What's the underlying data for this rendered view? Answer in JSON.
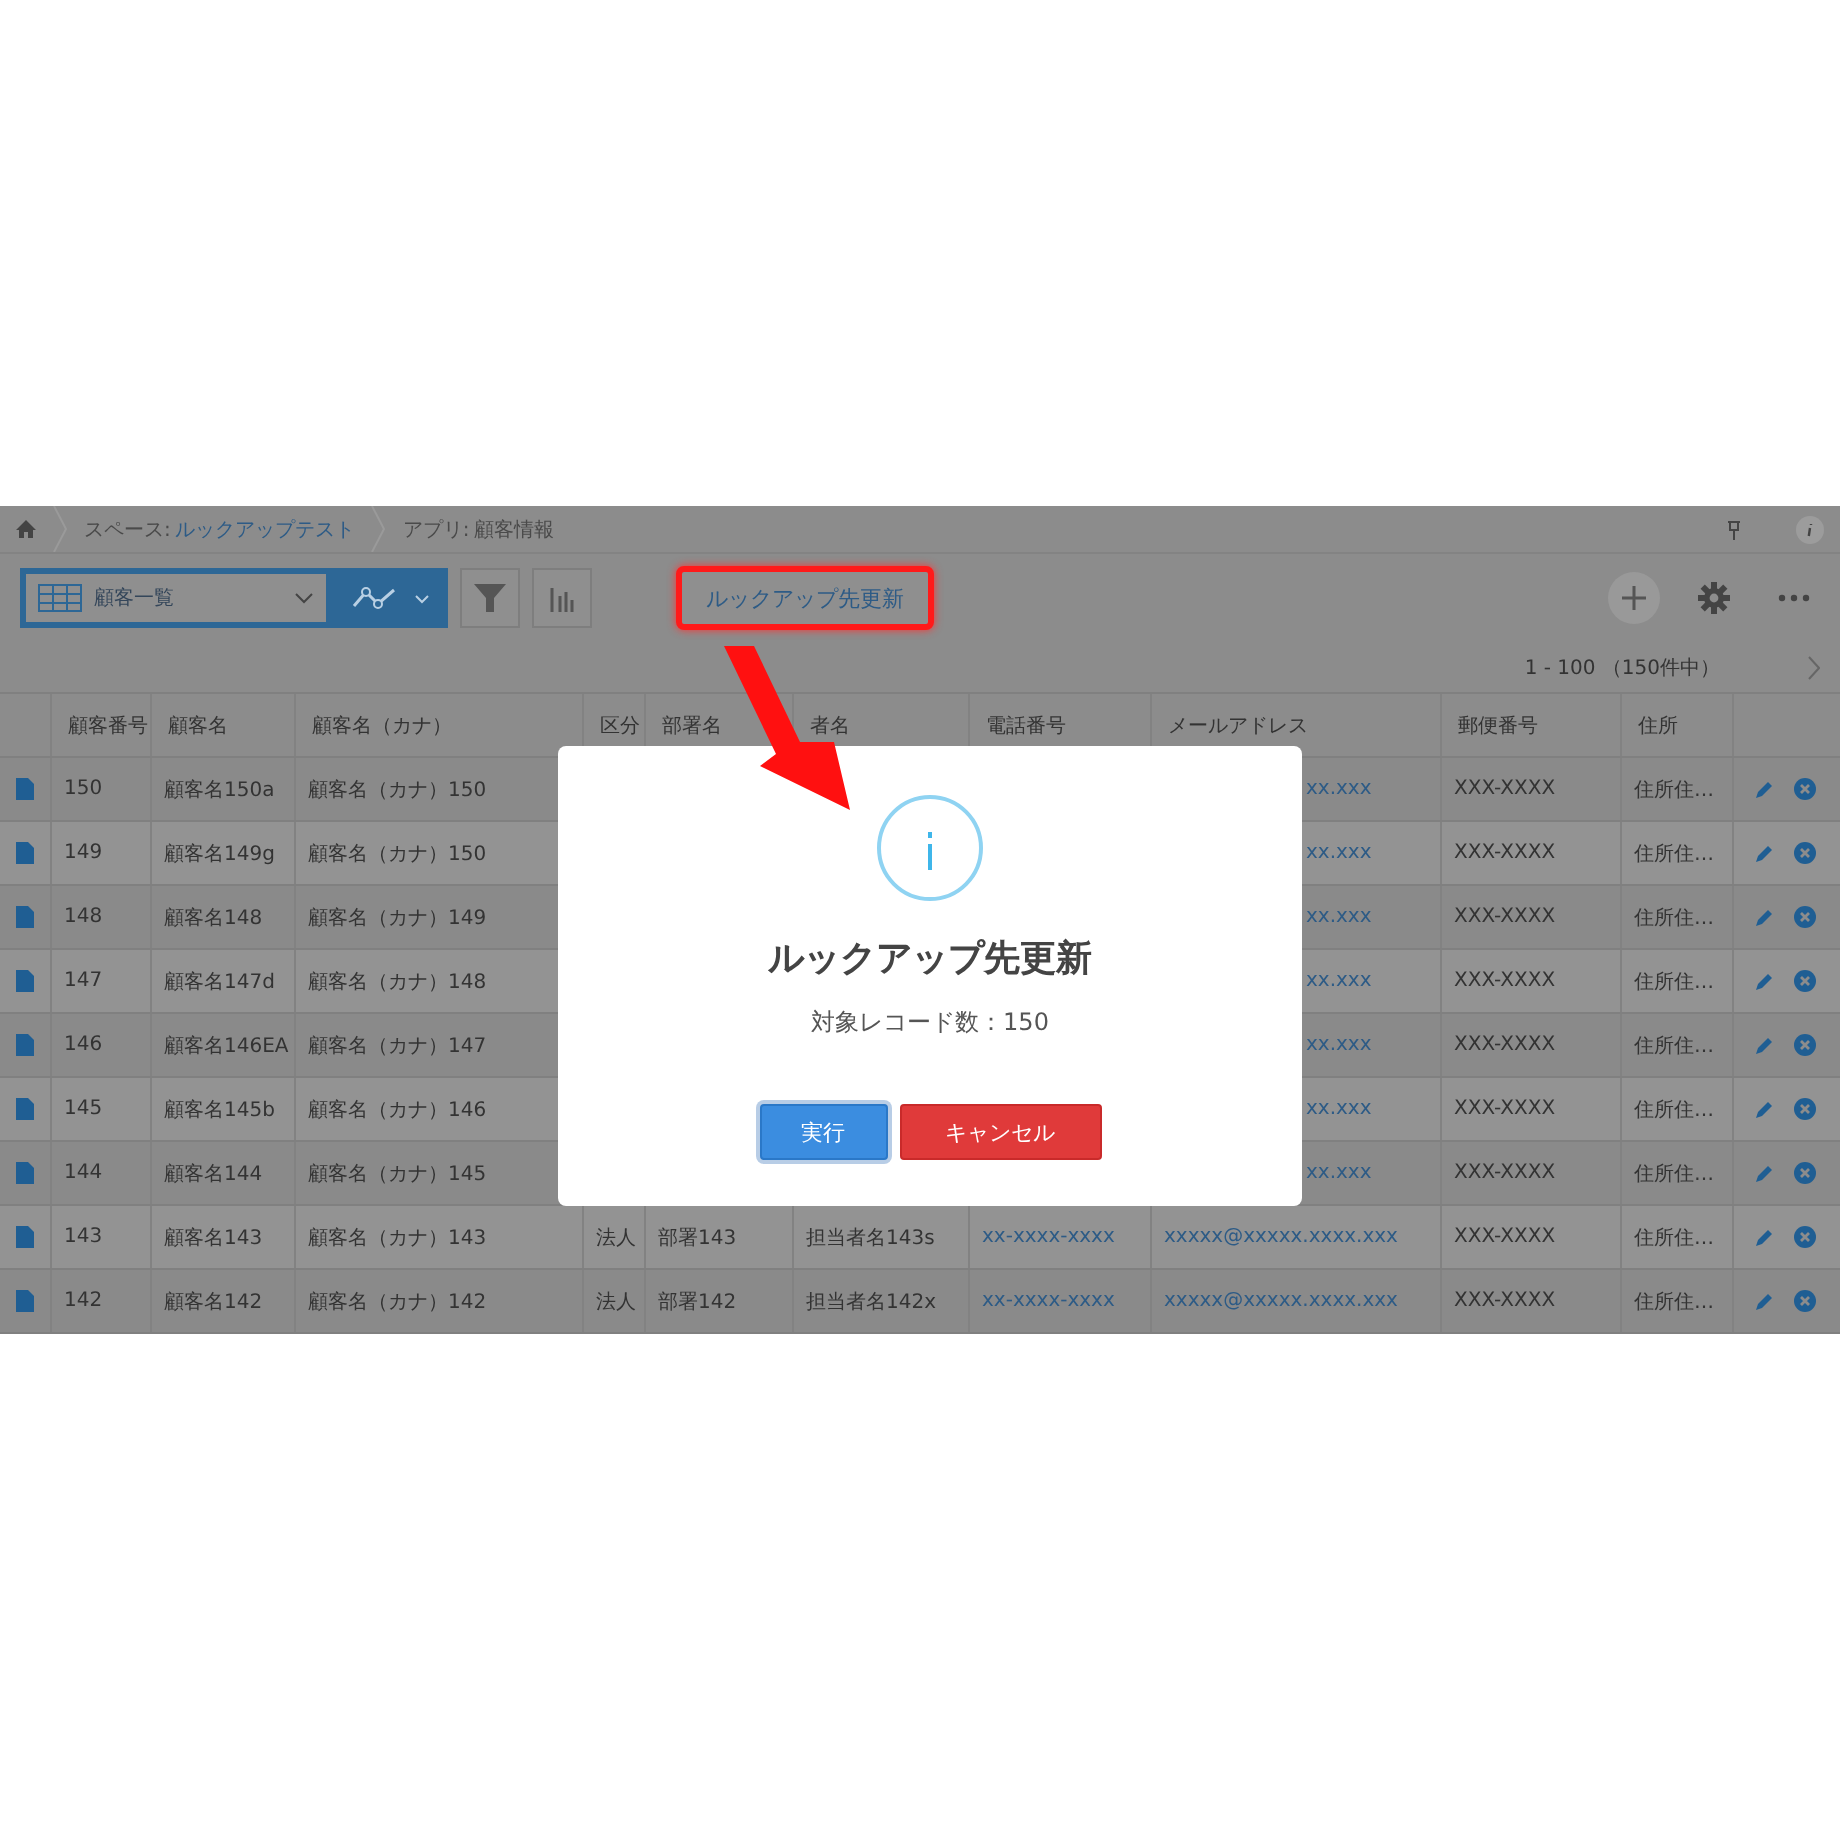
{
  "breadcrumbs": [
    {
      "prefix": "スペース:",
      "name": "ルックアップテスト",
      "link": true
    },
    {
      "prefix": "アプリ:",
      "name": "顧客情報",
      "link": false
    }
  ],
  "toolbar": {
    "view": "顧客一覧",
    "action_button": "ルックアップ先更新",
    "action_highlighted": true
  },
  "pager": {
    "range": "1 - 100 （150件中）"
  },
  "table": {
    "columns": [
      "",
      "顧客番号",
      "顧客名",
      "顧客名（カナ）",
      "区分",
      "部署名",
      "者名",
      "電話番号",
      "メールアドレス",
      "郵便番号",
      "住所",
      ""
    ],
    "rows": [
      {
        "covered": true,
        "no": "150",
        "name": "顧客名150a",
        "kana": "顧客名（カナ）150",
        "email": "xx.xxx",
        "zip": "XXX-XXXX",
        "address": "住所住…"
      },
      {
        "covered": true,
        "no": "149",
        "name": "顧客名149g",
        "kana": "顧客名（カナ）150",
        "email": "xx.xxx",
        "zip": "XXX-XXXX",
        "address": "住所住…"
      },
      {
        "covered": true,
        "no": "148",
        "name": "顧客名148",
        "kana": "顧客名（カナ）149",
        "email": "xx.xxx",
        "zip": "XXX-XXXX",
        "address": "住所住…"
      },
      {
        "covered": true,
        "no": "147",
        "name": "顧客名147d",
        "kana": "顧客名（カナ）148",
        "email": "xx.xxx",
        "zip": "XXX-XXXX",
        "address": "住所住…"
      },
      {
        "covered": true,
        "no": "146",
        "name": "顧客名146EA",
        "kana": "顧客名（カナ）147",
        "email": "xx.xxx",
        "zip": "XXX-XXXX",
        "address": "住所住…"
      },
      {
        "covered": true,
        "no": "145",
        "name": "顧客名145b",
        "kana": "顧客名（カナ）146",
        "email": "xx.xxx",
        "zip": "XXX-XXXX",
        "address": "住所住…"
      },
      {
        "covered": true,
        "no": "144",
        "name": "顧客名144",
        "kana": "顧客名（カナ）145",
        "email": "xx.xxx",
        "zip": "XXX-XXXX",
        "address": "住所住…"
      },
      {
        "covered": false,
        "no": "143",
        "name": "顧客名143",
        "kana": "顧客名（カナ）143",
        "type": "法人",
        "dept": "部署143",
        "person": "担当者名143s",
        "phone": "xx-xxxx-xxxx",
        "email": "xxxxx@xxxxx.xxxx.xxx",
        "zip": "XXX-XXXX",
        "address": "住所住…"
      },
      {
        "covered": false,
        "no": "142",
        "name": "顧客名142",
        "kana": "顧客名（カナ）142",
        "type": "法人",
        "dept": "部署142",
        "person": "担当者名142x",
        "phone": "xx-xxxx-xxxx",
        "email": "xxxxx@xxxxx.xxxx.xxx",
        "zip": "XXX-XXXX",
        "address": "住所住…"
      }
    ]
  },
  "dialog": {
    "title": "ルックアップ先更新",
    "message": "対象レコード数：150",
    "buttons": [
      {
        "label": "実行",
        "kind": "primary",
        "focused": true
      },
      {
        "label": "キャンセル",
        "kind": "danger",
        "focused": false
      }
    ]
  }
}
